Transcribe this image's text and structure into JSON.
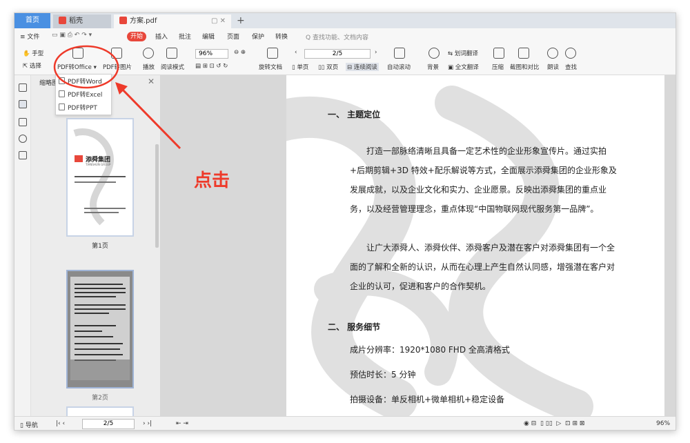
{
  "tabs": {
    "home": "首页",
    "t1": "稻壳",
    "t2": "方案.pdf",
    "t2_controls": "▢ ✕",
    "new": "+"
  },
  "menu": {
    "file": "≡ 文件",
    "start": "开始",
    "items": [
      "插入",
      "批注",
      "编辑",
      "页面",
      "保护",
      "转换"
    ],
    "search": "Q 查找功能、文档内容"
  },
  "ribbon": {
    "hand": "手型",
    "select": "选择",
    "pdf_office": "PDF转Office ▾",
    "pdf_image": "PDF转图片",
    "play": "播放",
    "read_mode": "阅读模式",
    "zoom": "96%",
    "rotate": "旋转文档",
    "page": "2/5",
    "single": "单页",
    "double": "双页",
    "continuous": "连续阅读",
    "autoscroll": "自动滚动",
    "background": "背景",
    "word_translate": "划词翻译",
    "full_translate": "全文翻译",
    "compress": "压缩",
    "screenshot": "截图和对比",
    "read": "朗读",
    "find": "查找"
  },
  "dropdown": {
    "items": [
      "PDF转Word",
      "PDF转Excel",
      "PDF转PPT"
    ]
  },
  "panel": {
    "title": "缩略图",
    "close": "✕",
    "page1": "第1页",
    "page2": "第2页",
    "thumb1_company": "添舜集团",
    "thumb1_sub": "TIANSHUN GROUP"
  },
  "doc": {
    "h1": "一、 主题定位",
    "p1": "打造一部脉络清晰且具备一定艺术性的企业形象宣传片。通过实拍+后期剪辑+3D 特效+配乐解说等方式，全面展示添舜集团的企业形象及发展成就，以及企业文化和实力、企业愿景。反映出添舜集团的重点业务，以及经营管理理念，重点体现“中国物联网现代服务第一品牌”。",
    "p2": "让广大添舜人、添舜伙伴、添舜客户及潜在客户对添舜集团有一个全面的了解和全新的认识，从而在心理上产生自然认同感，增强潜在客户对企业的认可，促进和客户的合作契机。",
    "h2": "二、 服务细节",
    "l1": "成片分辨率：1920*1080 FHD 全高清格式",
    "l2": "预估时长：5 分钟",
    "l3": "拍摄设备：单反相机+微单相机+稳定设备"
  },
  "status": {
    "nav": "导航",
    "page": "2/5",
    "zoom": "96%"
  },
  "annotation": {
    "text": "点击"
  },
  "colors": {
    "accent": "#4a90e2",
    "start": "#e8473b",
    "annotation": "#ee3a2a"
  }
}
